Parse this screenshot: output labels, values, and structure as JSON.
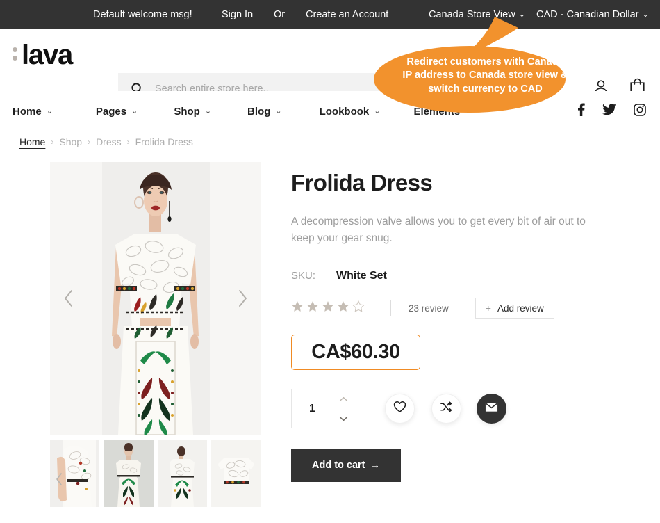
{
  "topbar": {
    "welcome": "Default welcome msg!",
    "sign_in": "Sign In",
    "or": "Or",
    "create_account": "Create an Account",
    "store_view": "Canada Store View",
    "currency": "CAD - Canadian Dollar",
    "caret": "⌄",
    "bg_color": "#333333"
  },
  "header": {
    "logo_text": "lava",
    "search_placeholder": "Search entire store here..",
    "search_value": "",
    "icons": [
      "search-icon",
      "account-icon",
      "shopping-bag-icon"
    ]
  },
  "nav": {
    "items": [
      {
        "label": "Home"
      },
      {
        "label": "Pages"
      },
      {
        "label": "Shop"
      },
      {
        "label": "Blog"
      },
      {
        "label": "Lookbook"
      },
      {
        "label": "Elements"
      }
    ],
    "caret": "⌄",
    "social": [
      "facebook-icon",
      "twitter-icon",
      "instagram-icon"
    ]
  },
  "breadcrumb": {
    "separator": "›",
    "items": [
      {
        "label": "Home",
        "current": false
      },
      {
        "label": "Shop",
        "current": false
      },
      {
        "label": "Dress",
        "current": false
      },
      {
        "label": "Frolida Dress",
        "current": true
      }
    ]
  },
  "gallery": {
    "prev_arrow": "‹",
    "next_arrow": "›",
    "thumb_prev_arrow": "‹",
    "thumb_count": 4
  },
  "product": {
    "title": "Frolida Dress",
    "description": "A decompression valve allows you to get every bit of air out to keep your gear  snug.",
    "sku_label": "SKU:",
    "sku_value": "White Set",
    "rating_filled": 4,
    "rating_total": 5,
    "star_color": "#c5bdb4",
    "review_count": "23 review",
    "add_review_label": "Add review",
    "add_review_plus": "+",
    "price": "CA$60.30",
    "price_border_color": "#f08b24",
    "quantity": "1",
    "qty_up": "⌃",
    "qty_down": "⌄",
    "wishlist_icon": "heart-icon",
    "compare_icon": "shuffle-icon",
    "email_icon": "envelope-icon",
    "add_to_cart_label": "Add to cart",
    "add_to_cart_arrow": "→"
  },
  "callout": {
    "text": "Redirect customers with Canada IP address to Canada store view & switch currency to CAD",
    "color": "#f2922d"
  }
}
